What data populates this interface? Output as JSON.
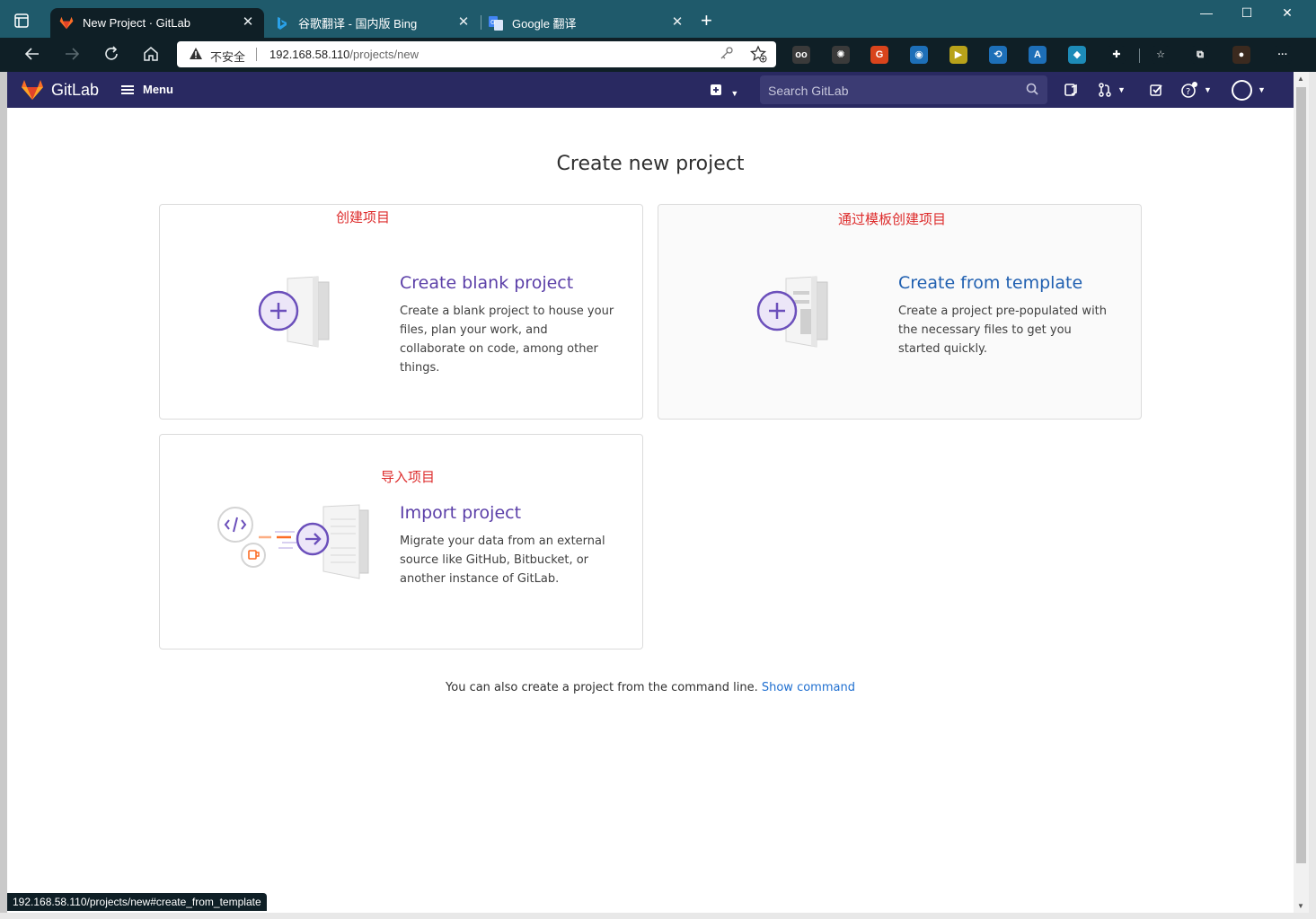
{
  "browser": {
    "tabs": [
      {
        "title": "New Project · GitLab",
        "active": true
      },
      {
        "title": "谷歌翻译 - 国内版 Bing",
        "active": false
      },
      {
        "title": "Google 翻译",
        "active": false
      }
    ],
    "close_glyph": "✕",
    "new_tab_glyph": "+",
    "window_controls": {
      "minimize": "—",
      "maximize": "☐",
      "close": "✕"
    },
    "address": {
      "security_label": "不安全",
      "host": "192.168.58.110",
      "path": "/projects/new"
    },
    "extensions": [
      {
        "icon": "reader-icon",
        "color": "#3a3a3a",
        "glyph": "oo"
      },
      {
        "icon": "settings-ext-icon",
        "color": "#3a3a3a",
        "glyph": "✺"
      },
      {
        "icon": "translate-ext-icon",
        "color": "#d9441c",
        "glyph": "G"
      },
      {
        "icon": "circle-ext-icon",
        "color": "#1d6fb8",
        "glyph": "◉"
      },
      {
        "icon": "console-ext-icon",
        "color": "#b8a21a",
        "glyph": "▶"
      },
      {
        "icon": "repeat-ext-icon",
        "color": "#1d6fb8",
        "glyph": "⟲"
      },
      {
        "icon": "font-ext-icon",
        "color": "#1d6fb8",
        "glyph": "A"
      },
      {
        "icon": "shield-ext-icon",
        "color": "#1d8bb8",
        "glyph": "◆"
      },
      {
        "icon": "puzzle-icon",
        "color": "#0f1f26",
        "glyph": "✚"
      },
      {
        "icon": "favorites-icon",
        "color": "#0f1f26",
        "glyph": "☆"
      },
      {
        "icon": "collections-icon",
        "color": "#0f1f26",
        "glyph": "⧉"
      },
      {
        "icon": "profile-icon",
        "color": "#3b2a1f",
        "glyph": "●"
      },
      {
        "icon": "more-icon",
        "color": "#0f1f26",
        "glyph": "···"
      }
    ],
    "status_url": "192.168.58.110/projects/new#create_from_template"
  },
  "gitlab": {
    "brand": "GitLab",
    "menu_label": "Menu",
    "search_placeholder": "Search GitLab",
    "brand_color": "#292961"
  },
  "page": {
    "title": "Create new project",
    "cards": [
      {
        "note": "创建项目",
        "title": "Create blank project",
        "description": "Create a blank project to house your files, plan your work, and collaborate on code, among other things."
      },
      {
        "note": "通过模板创建项目",
        "title": "Create from template",
        "description": "Create a project pre-populated with the necessary files to get you started quickly."
      },
      {
        "note": "导入项目",
        "title": "Import project",
        "description": "Migrate your data from an external source like GitHub, Bitbucket, or another instance of GitLab."
      }
    ],
    "cli_text": "You can also create a project from the command line.",
    "cli_link": "Show command"
  }
}
